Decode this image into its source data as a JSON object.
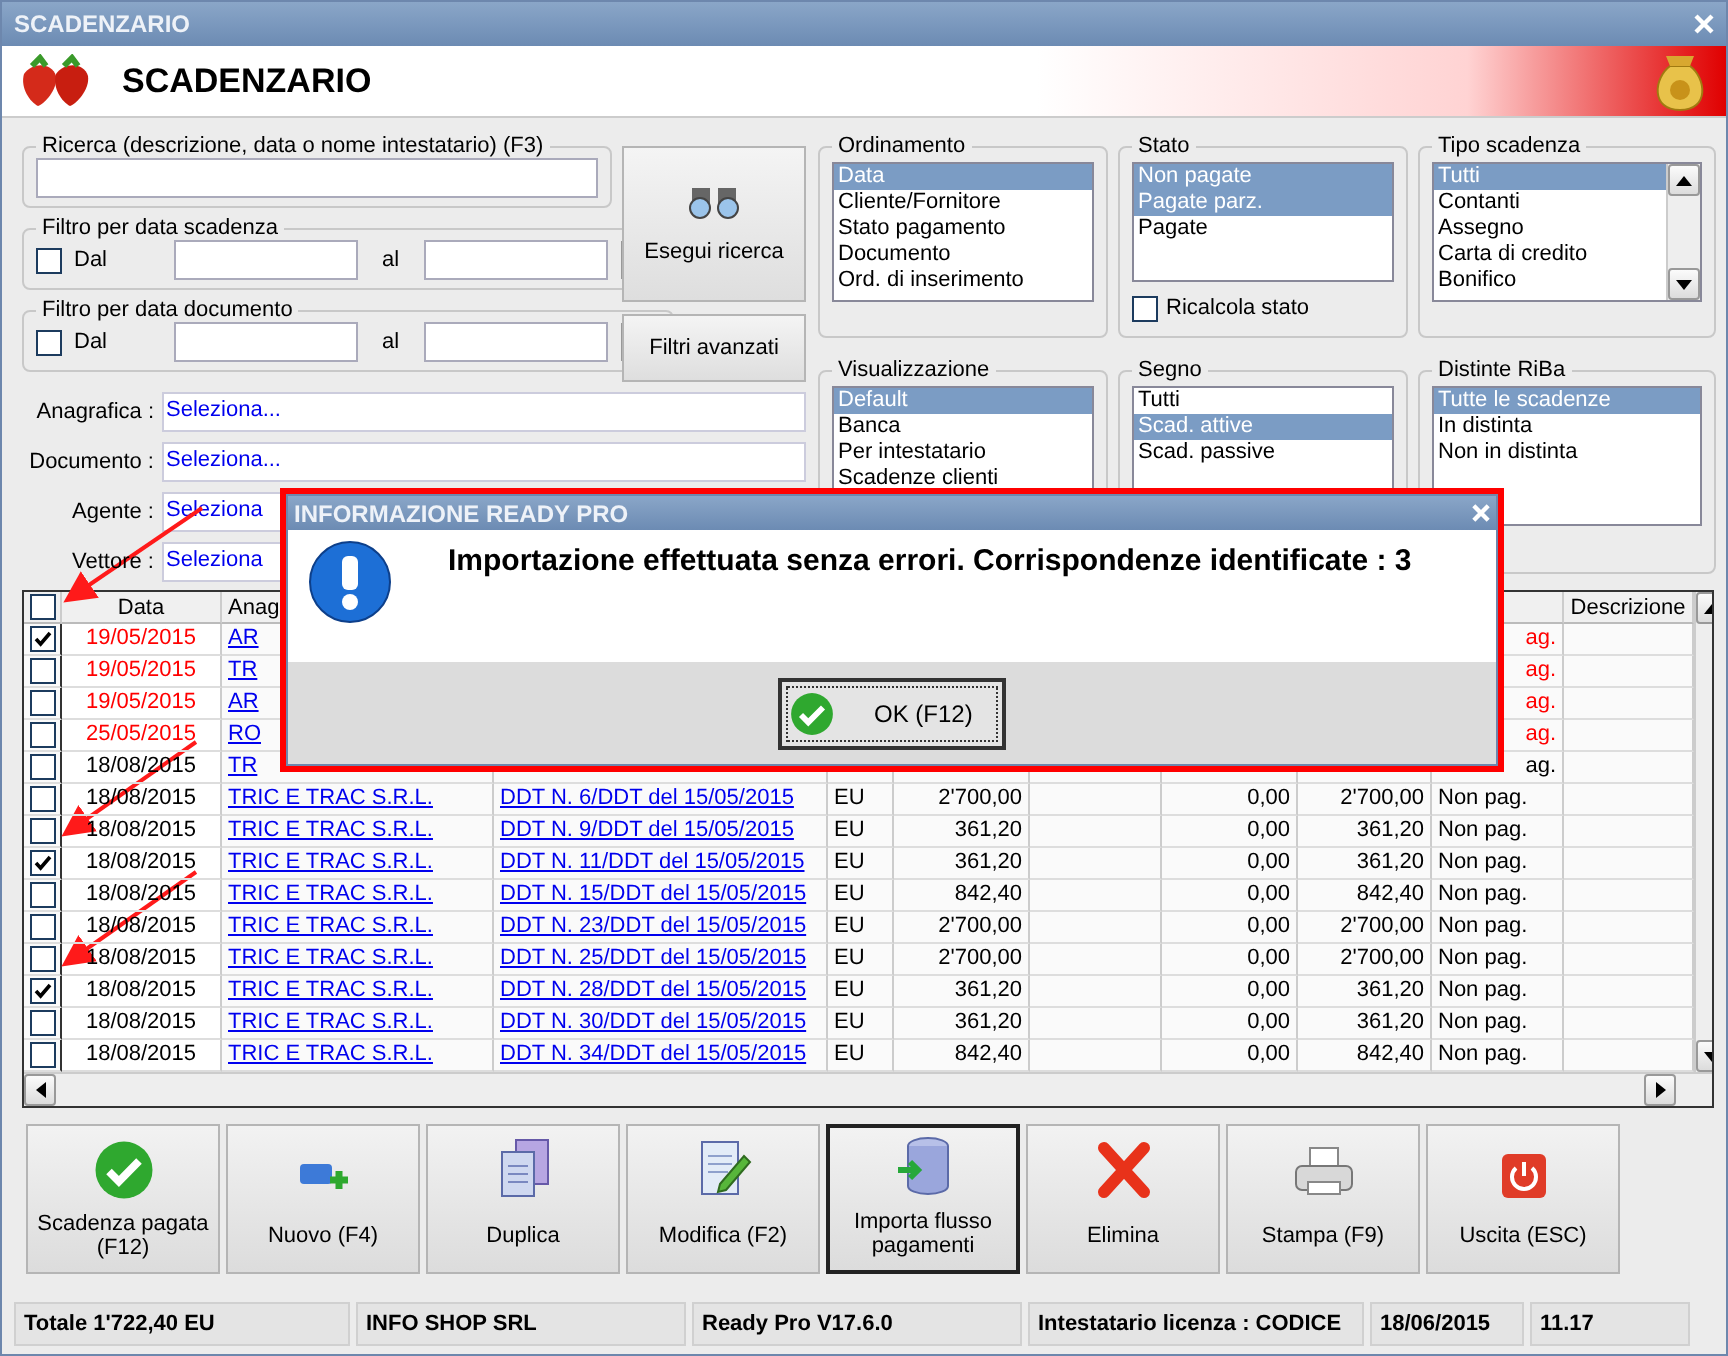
{
  "window": {
    "title": "SCADENZARIO"
  },
  "header": {
    "title": "SCADENZARIO"
  },
  "search": {
    "label": "Ricerca (descrizione, data o nome intestatario) (F3)"
  },
  "date_filters": [
    {
      "label": "Filtro per data scadenza",
      "from_label": "Dal",
      "checked": false,
      "to_label": "al"
    },
    {
      "label": "Filtro per data documento",
      "from_label": "Dal",
      "checked": false,
      "to_label": "al"
    }
  ],
  "search_button": "Esegui ricerca",
  "advanced_button": "Filtri avanzati",
  "selectors": [
    {
      "label": "Anagrafica :",
      "value": "Seleziona..."
    },
    {
      "label": "Documento :",
      "value": "Seleziona..."
    },
    {
      "label": "Agente :",
      "value": "Seleziona"
    },
    {
      "label": "Vettore :",
      "value": "Seleziona"
    }
  ],
  "list_groups": [
    {
      "title": "Ordinamento",
      "items": [
        {
          "label": "Data",
          "selected": true
        },
        {
          "label": "Cliente/Fornitore",
          "selected": false
        },
        {
          "label": "Stato pagamento",
          "selected": false
        },
        {
          "label": "Documento",
          "selected": false
        },
        {
          "label": "Ord. di inserimento",
          "selected": false
        }
      ]
    },
    {
      "title": "Stato",
      "items": [
        {
          "label": "Non pagate",
          "selected": true
        },
        {
          "label": "Pagate parz.",
          "selected": true
        },
        {
          "label": "Pagate",
          "selected": false
        }
      ],
      "checkbox": {
        "label": "Ricalcola stato",
        "checked": false
      }
    },
    {
      "title": "Tipo scadenza",
      "scrollable": true,
      "items": [
        {
          "label": "Tutti",
          "selected": true
        },
        {
          "label": "Contanti",
          "selected": false
        },
        {
          "label": "Assegno",
          "selected": false
        },
        {
          "label": "Carta di credito",
          "selected": false
        },
        {
          "label": "Bonifico",
          "selected": false
        }
      ]
    },
    {
      "title": "Visualizzazione",
      "items": [
        {
          "label": "Default",
          "selected": true
        },
        {
          "label": "Banca",
          "selected": false
        },
        {
          "label": "Per intestatario",
          "selected": false
        },
        {
          "label": "Scadenze clienti",
          "selected": false
        }
      ]
    },
    {
      "title": "Segno",
      "items": [
        {
          "label": "Tutti",
          "selected": false
        },
        {
          "label": "Scad. attive",
          "selected": true
        },
        {
          "label": "Scad. passive",
          "selected": false
        }
      ]
    },
    {
      "title": "Distinte RiBa",
      "items": [
        {
          "label": "Tutte le scadenze",
          "selected": true
        },
        {
          "label": "In distinta",
          "selected": false
        },
        {
          "label": "Non in distinta",
          "selected": false
        }
      ]
    }
  ],
  "table": {
    "header": {
      "checked": false,
      "date": "Data",
      "anagrafica": "Anag",
      "descrizione": "Descrizione"
    },
    "rows": [
      {
        "checked": true,
        "overdue": true,
        "date": "19/05/2015",
        "anagrafica": "AR",
        "status": "ag."
      },
      {
        "checked": false,
        "overdue": true,
        "date": "19/05/2015",
        "anagrafica": "TR",
        "status": "ag."
      },
      {
        "checked": false,
        "overdue": true,
        "date": "19/05/2015",
        "anagrafica": "AR",
        "status": "ag."
      },
      {
        "checked": false,
        "overdue": true,
        "date": "25/05/2015",
        "anagrafica": "RO",
        "status": "ag."
      },
      {
        "checked": false,
        "overdue": false,
        "date": "18/08/2015",
        "anagrafica": "TR",
        "status": "ag."
      },
      {
        "checked": false,
        "overdue": false,
        "date": "18/08/2015",
        "anagrafica": "TRIC E TRAC S.R.L.",
        "documento": "DDT N. 6/DDT del 15/05/2015",
        "currency": "EU",
        "amount": "2'700,00",
        "paid": "0,00",
        "residual": "2'700,00",
        "status": "Non pag."
      },
      {
        "checked": false,
        "overdue": false,
        "date": "18/08/2015",
        "anagrafica": "TRIC E TRAC S.R.L.",
        "documento": "DDT N. 9/DDT del 15/05/2015",
        "currency": "EU",
        "amount": "361,20",
        "paid": "0,00",
        "residual": "361,20",
        "status": "Non pag."
      },
      {
        "checked": true,
        "overdue": false,
        "date": "18/08/2015",
        "anagrafica": "TRIC E TRAC S.R.L.",
        "documento": "DDT N. 11/DDT del 15/05/2015",
        "currency": "EU",
        "amount": "361,20",
        "paid": "0,00",
        "residual": "361,20",
        "status": "Non pag."
      },
      {
        "checked": false,
        "overdue": false,
        "date": "18/08/2015",
        "anagrafica": "TRIC E TRAC S.R.L.",
        "documento": "DDT N. 15/DDT del 15/05/2015",
        "currency": "EU",
        "amount": "842,40",
        "paid": "0,00",
        "residual": "842,40",
        "status": "Non pag."
      },
      {
        "checked": false,
        "overdue": false,
        "date": "18/08/2015",
        "anagrafica": "TRIC E TRAC S.R.L.",
        "documento": "DDT N. 23/DDT del 15/05/2015",
        "currency": "EU",
        "amount": "2'700,00",
        "paid": "0,00",
        "residual": "2'700,00",
        "status": "Non pag."
      },
      {
        "checked": false,
        "overdue": false,
        "date": "18/08/2015",
        "anagrafica": "TRIC E TRAC S.R.L.",
        "documento": "DDT N. 25/DDT del 15/05/2015",
        "currency": "EU",
        "amount": "2'700,00",
        "paid": "0,00",
        "residual": "2'700,00",
        "status": "Non pag."
      },
      {
        "checked": true,
        "overdue": false,
        "date": "18/08/2015",
        "anagrafica": "TRIC E TRAC S.R.L.",
        "documento": "DDT N. 28/DDT del 15/05/2015",
        "currency": "EU",
        "amount": "361,20",
        "paid": "0,00",
        "residual": "361,20",
        "status": "Non pag."
      },
      {
        "checked": false,
        "overdue": false,
        "date": "18/08/2015",
        "anagrafica": "TRIC E TRAC S.R.L.",
        "documento": "DDT N. 30/DDT del 15/05/2015",
        "currency": "EU",
        "amount": "361,20",
        "paid": "0,00",
        "residual": "361,20",
        "status": "Non pag."
      },
      {
        "checked": false,
        "overdue": false,
        "date": "18/08/2015",
        "anagrafica": "TRIC E TRAC S.R.L.",
        "documento": "DDT N. 34/DDT del 15/05/2015",
        "currency": "EU",
        "amount": "842,40",
        "paid": "0,00",
        "residual": "842,40",
        "status": "Non pag."
      }
    ]
  },
  "actions": [
    {
      "kind": "paid",
      "label": "Scadenza pagata (F12)",
      "selected": false
    },
    {
      "kind": "new",
      "label": "Nuovo (F4)",
      "selected": false
    },
    {
      "kind": "duplicate",
      "label": "Duplica",
      "selected": false
    },
    {
      "kind": "edit",
      "label": "Modifica (F2)",
      "selected": false
    },
    {
      "kind": "import",
      "label": "Importa flusso pagamenti",
      "selected": true
    },
    {
      "kind": "delete",
      "label": "Elimina",
      "selected": false
    },
    {
      "kind": "print",
      "label": "Stampa (F9)",
      "selected": false
    },
    {
      "kind": "exit",
      "label": "Uscita (ESC)",
      "selected": false
    }
  ],
  "status_bar": [
    "Totale 1'722,40 EU",
    "INFO SHOP SRL",
    "Ready Pro V17.6.0",
    "Intestatario licenza : CODICE",
    "18/06/2015",
    "11.17"
  ],
  "dialog": {
    "title": "INFORMAZIONE READY PRO",
    "message": "Importazione effettuata senza errori. Corrispondenze identificate : 3",
    "button": "OK (F12)"
  }
}
